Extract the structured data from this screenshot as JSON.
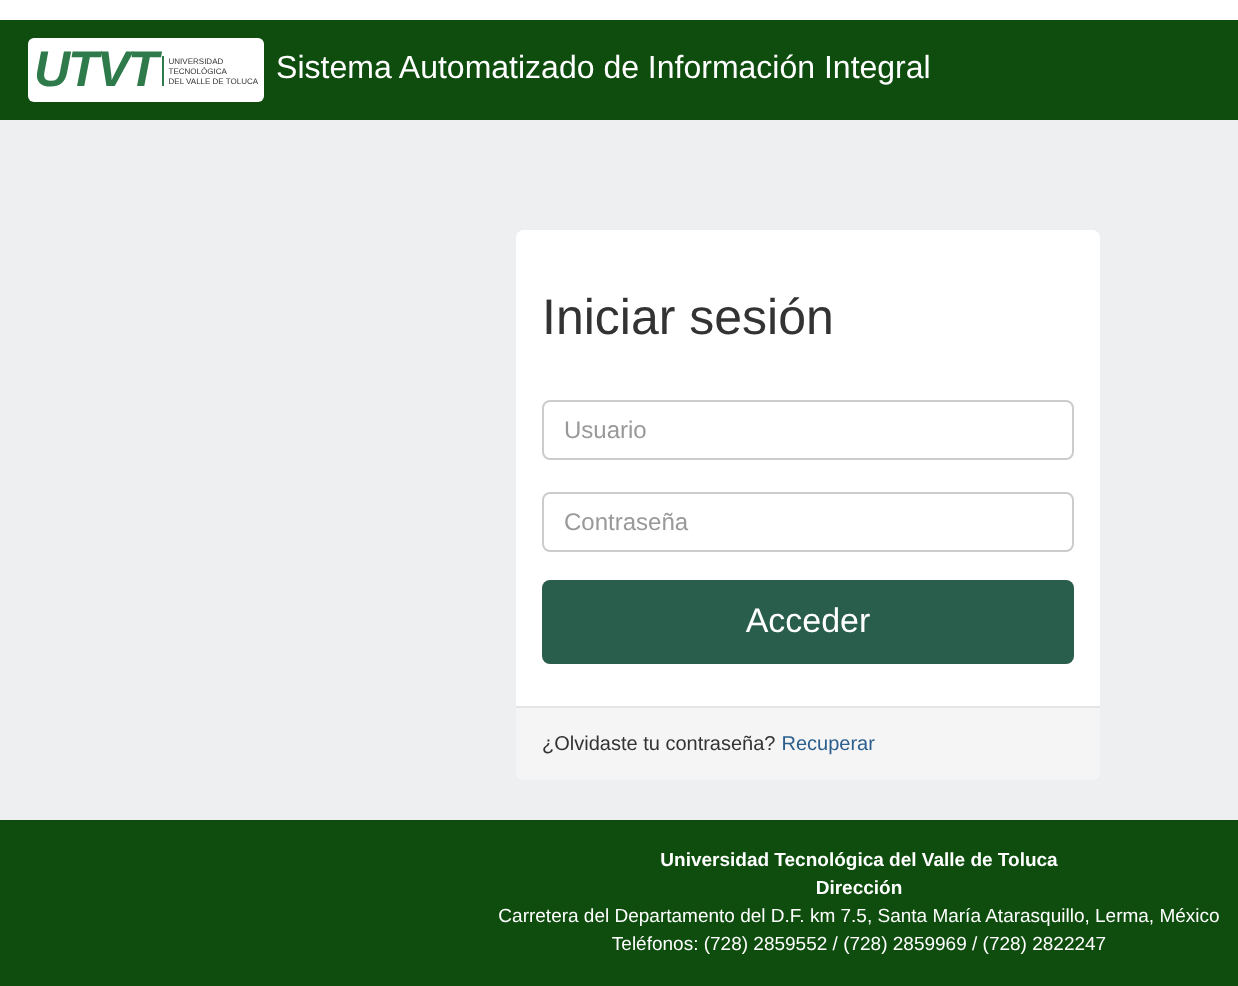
{
  "header": {
    "logo": {
      "mark": "UTVT",
      "lines": [
        "UNIVERSIDAD",
        "TECNOLÓGICA",
        "DEL VALLE DE TOLUCA"
      ]
    },
    "title": "Sistema Automatizado de Información Integral"
  },
  "login": {
    "title": "Iniciar sesión",
    "fields": [
      {
        "placeholder": "Usuario"
      },
      {
        "placeholder": "Contraseña"
      }
    ],
    "button": "Acceder",
    "forgot": "¿Olvidaste tu contraseña?",
    "recover": "Recuperar"
  },
  "footer": {
    "name": "Universidad Tecnológica del Valle de Toluca",
    "section": "Dirección",
    "address": "Carretera del Departamento del D.F. km 7.5, Santa María Atarasquillo, Lerma, México",
    "phones": "Teléfonos: (728) 2859552 / (728) 2859969 / (728) 2822247"
  }
}
